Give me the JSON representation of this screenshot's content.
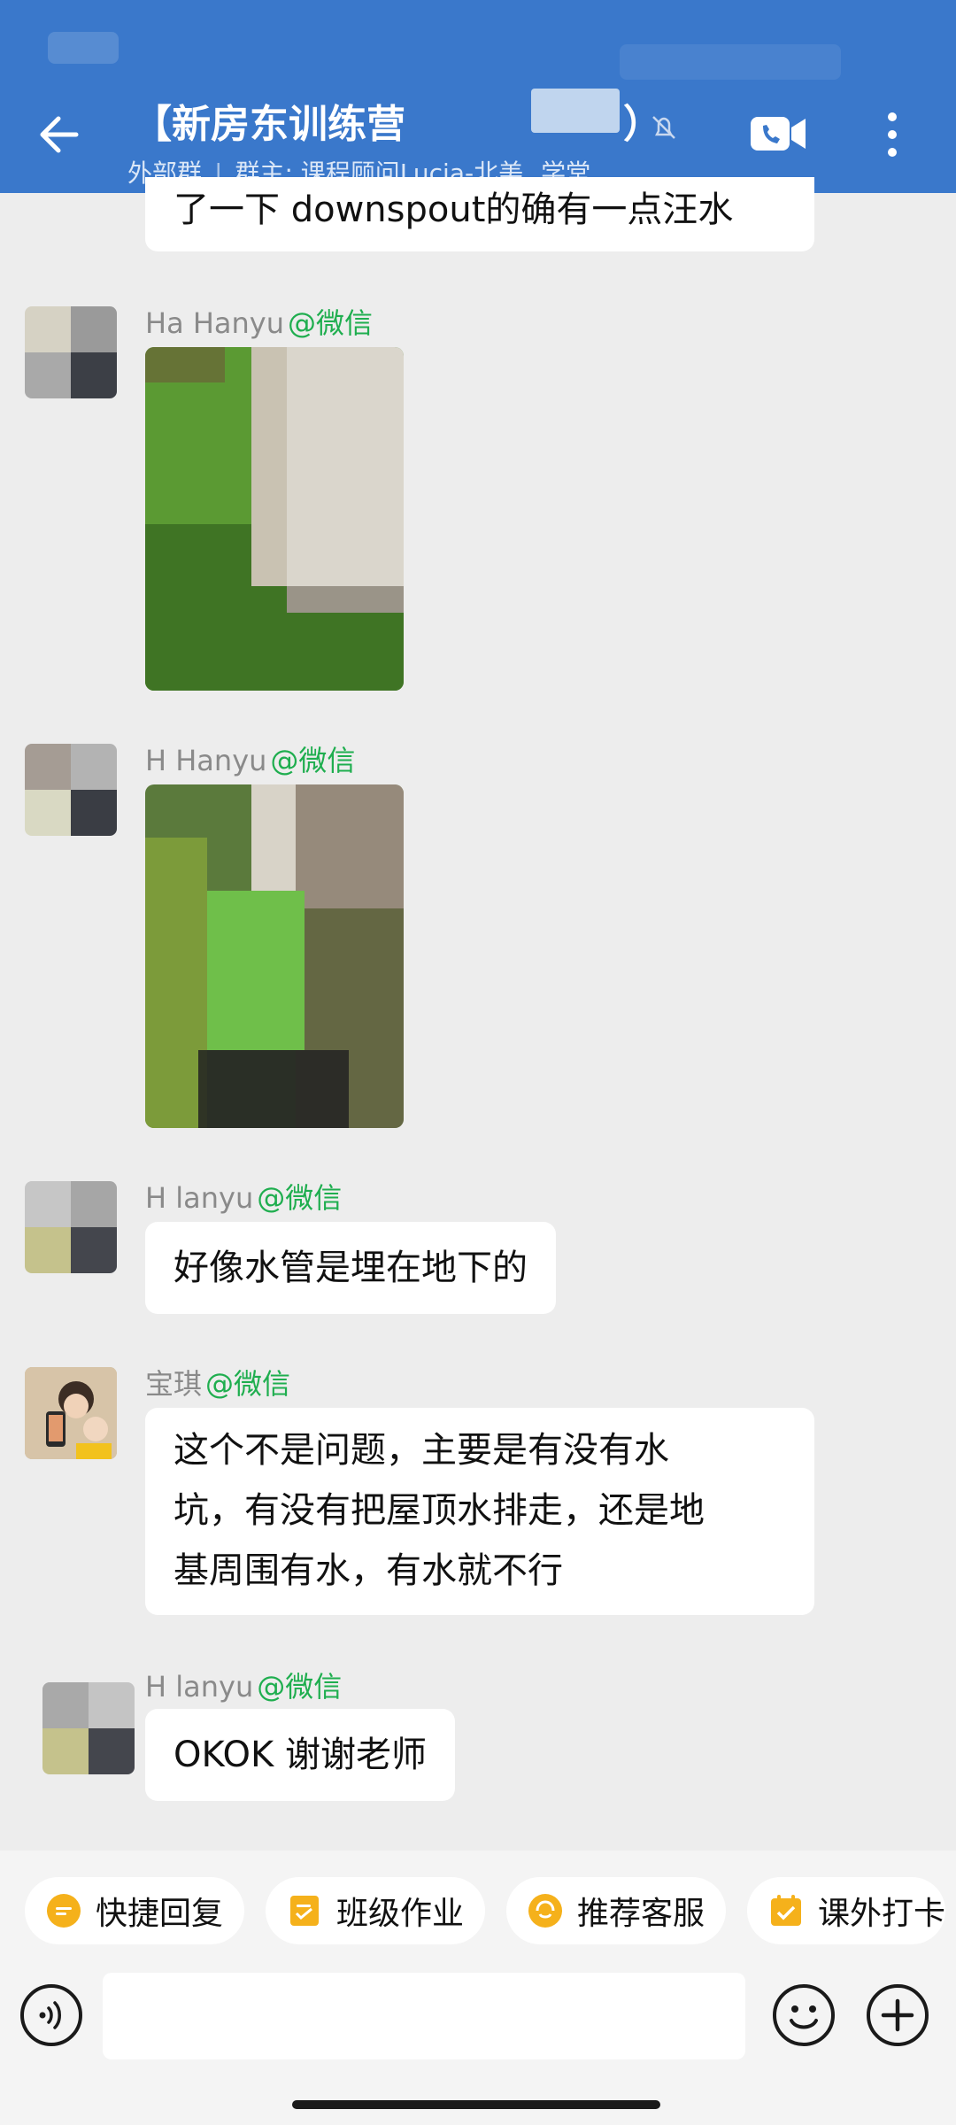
{
  "header": {
    "title": "【新房东训练营",
    "title_suffix": "）",
    "subtitle_left": "外部群",
    "subtitle_sep": "|",
    "subtitle_right": "群主: 课程顾问Lucia-北美",
    "subtitle_tail": "学堂"
  },
  "messages": [
    {
      "type": "text",
      "text": "了一下 downspout的确有一点汪水"
    },
    {
      "type": "image",
      "name": "Ha        Hanyu",
      "tag": "@微信",
      "image": "photo-downspout-grass"
    },
    {
      "type": "image",
      "name": "H         Hanyu",
      "tag": "@微信",
      "image": "photo-side-yard"
    },
    {
      "type": "text",
      "name": "H         lanyu",
      "tag": "@微信",
      "text": "好像水管是埋在地下的"
    },
    {
      "type": "text",
      "name": "宝琪",
      "tag": "@微信",
      "lines": [
        "这个不是问题，主要是有没有水",
        "坑，有没有把屋顶水排走，还是地",
        "基周围有水，有水就不行"
      ]
    },
    {
      "type": "text",
      "name": "H         lanyu",
      "tag": "@微信",
      "text": "OKOK 谢谢老师"
    }
  ],
  "quick_replies": [
    {
      "label": "快捷回复",
      "icon": "chat-bubble-icon",
      "color": "#f5b11b"
    },
    {
      "label": "班级作业",
      "icon": "clipboard-icon",
      "color": "#f5b11b"
    },
    {
      "label": "推荐客服",
      "icon": "service-icon",
      "color": "#f5b11b"
    },
    {
      "label": "课外打卡",
      "icon": "calendar-check-icon",
      "color": "#f5b11b"
    }
  ],
  "colors": {
    "header_bg": "#3a78cb",
    "wechat_tag": "#1fae4f",
    "background": "#ededed"
  }
}
